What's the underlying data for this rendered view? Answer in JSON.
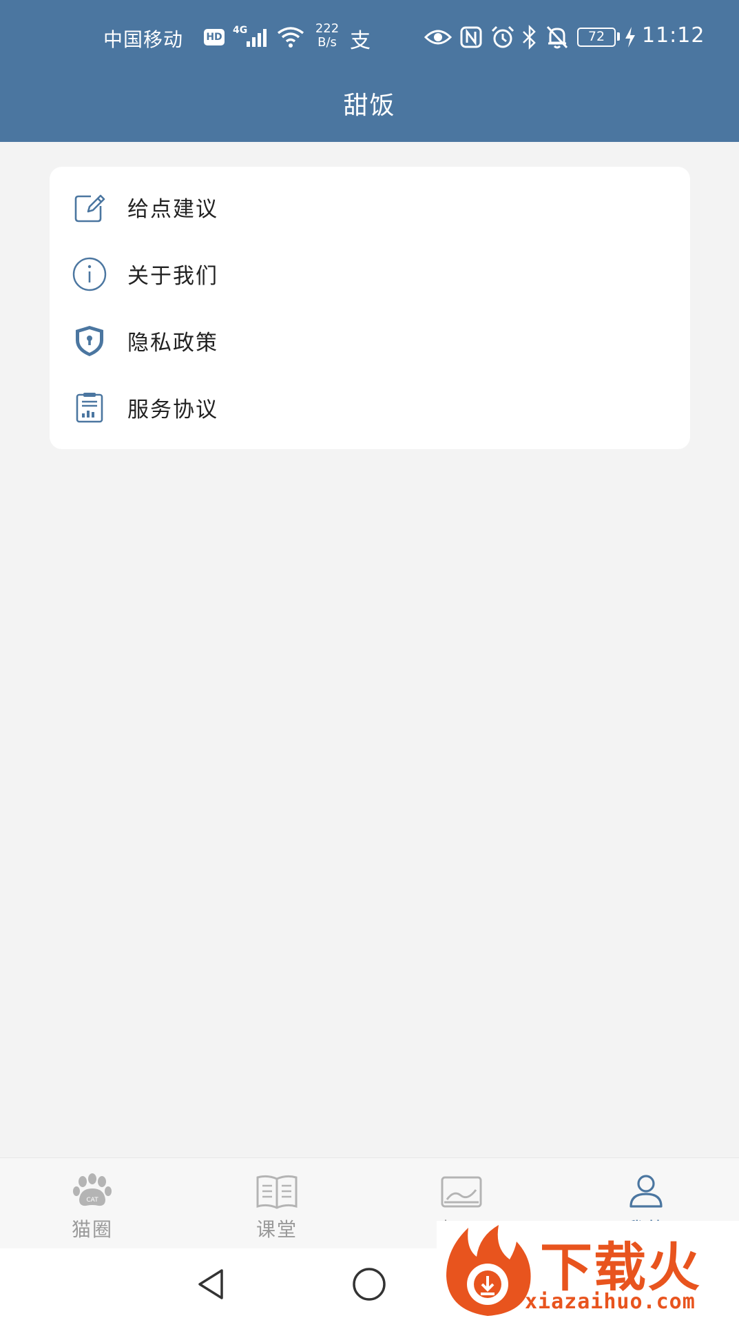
{
  "status_bar": {
    "carrier": "中国移动",
    "hd_badge": "HD",
    "network_type": "4G",
    "net_speed_value": "222",
    "net_speed_unit": "B/s",
    "pay_icon": "支",
    "battery_level": "72",
    "time": "11:12"
  },
  "header": {
    "title": "甜饭"
  },
  "menu": {
    "items": [
      {
        "label": "给点建议",
        "icon": "edit-icon"
      },
      {
        "label": "关于我们",
        "icon": "info-icon"
      },
      {
        "label": "隐私政策",
        "icon": "shield-lock-icon"
      },
      {
        "label": "服务协议",
        "icon": "document-chart-icon"
      }
    ]
  },
  "tabs": [
    {
      "label": "猫圈",
      "icon": "paw-icon",
      "icon_text": "CAT",
      "active": false
    },
    {
      "label": "课堂",
      "icon": "book-icon",
      "active": false
    },
    {
      "label": "相册",
      "icon": "photo-icon",
      "active": false
    },
    {
      "label": "我的",
      "icon": "user-icon",
      "active": true
    }
  ],
  "watermark": {
    "brand": "下载火",
    "domain": "xiazaihuo.com"
  },
  "colors": {
    "primary": "#4b76a0",
    "background": "#f3f3f3",
    "inactive_tab": "#9a9a9a",
    "watermark": "#e8541e"
  }
}
